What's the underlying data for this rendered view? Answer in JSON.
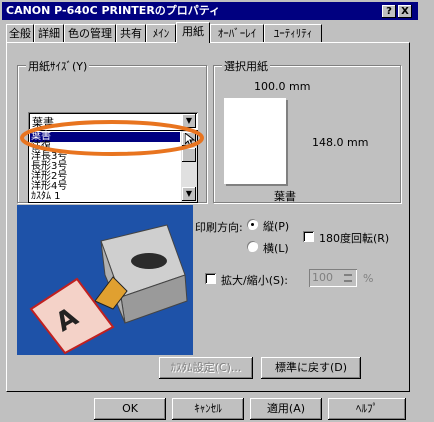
{
  "window": {
    "title": "CANON P-640C PRINTERのプロパティ",
    "help_btn": "?",
    "close_btn": "X"
  },
  "tabs": [
    "全般",
    "詳細",
    "色の管理",
    "共有",
    "ﾒｲﾝ",
    "用紙",
    "ｵｰﾊﾞｰﾚｲ",
    "ﾕｰﾃｨﾘﾃｨ"
  ],
  "active_tab": "用紙",
  "paper_size": {
    "label": "用紙ｻｲｽﾞ(Y)",
    "selected": "葉書",
    "options": [
      "葉書",
      "往復",
      "洋長3号",
      "長形3号",
      "洋形2号",
      "洋形4号",
      "ｶｽﾀﾑ 1"
    ]
  },
  "selected_paper": {
    "label": "選択用紙",
    "width": "100.0 mm",
    "height": "148.0 mm",
    "name": "葉書"
  },
  "orientation": {
    "label": "印刷方向:",
    "portrait": "縦(P)",
    "landscape": "横(L)",
    "selected": "portrait"
  },
  "rotate180": {
    "label": "180度回転(R)",
    "checked": false
  },
  "scale": {
    "label": "拡大/縮小(S):",
    "value": "100",
    "unit": "%",
    "checked": false
  },
  "buttons": {
    "custom": "ｶｽﾀﾑ設定(C)...",
    "default": "標準に戻す(D)",
    "ok": "OK",
    "cancel": "ｷｬﾝｾﾙ",
    "apply": "適用(A)",
    "help": "ﾍﾙﾌﾟ"
  },
  "illustration": {
    "letter": "A"
  },
  "colors": {
    "titlebar": "#000080",
    "face": "#c0c0c0",
    "highlight_ring": "#e8741f",
    "selection": "#000080",
    "illustration_bg": "#1e52a8"
  }
}
